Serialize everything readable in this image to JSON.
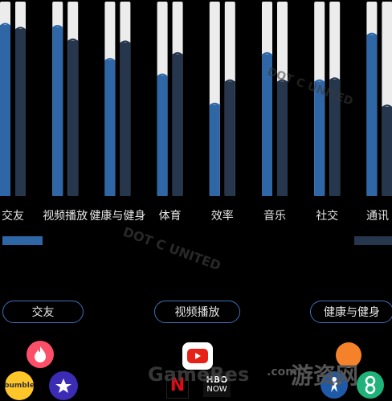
{
  "chart_data": {
    "type": "bar",
    "categories": [
      "交友",
      "视频播放",
      "健康与健身",
      "体育",
      "效率",
      "音乐",
      "社交",
      "通讯"
    ],
    "series": [
      {
        "values": [
          0.88,
          0.87,
          0.7,
          0.62,
          0.47,
          0.73,
          0.59,
          0.83
        ],
        "color": "#2f66a6"
      },
      {
        "values": [
          0.86,
          0.8,
          0.79,
          0.73,
          0.59,
          0.59,
          0.6,
          0.46
        ],
        "color": "#26364d"
      }
    ],
    "ylim": [
      0,
      1
    ]
  },
  "pills": {
    "dating": "交友",
    "video": "视频播放",
    "fitness": "健康与健身"
  },
  "apps": {
    "hbo_text": "HBO",
    "hbo_now": "NOW",
    "bumble": "bumble",
    "netflix": "N"
  },
  "watermark": {
    "brand": "GameRes",
    "suffix": ".com",
    "cn": "游资网",
    "dotc": "DOT C UNITED"
  },
  "colors": {
    "blue": "#2f66a6",
    "dark": "#26364d",
    "track": "#ececec",
    "pill_border": "#3d6fb5"
  }
}
